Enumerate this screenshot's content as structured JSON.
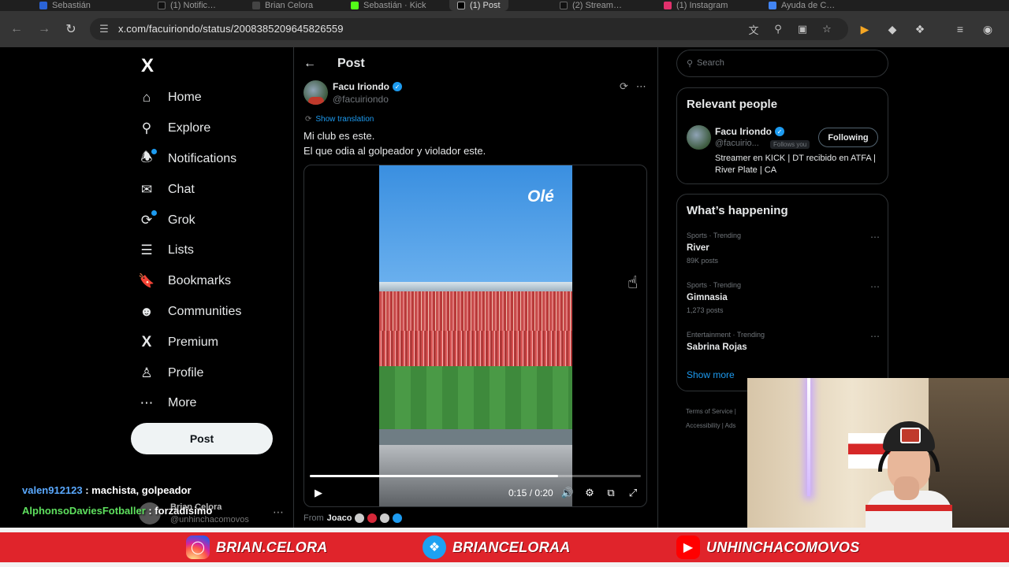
{
  "browser": {
    "tabs": [
      "Sebastián",
      "(1) Notific…",
      "Brian Celora",
      "Sebastián · Kick",
      "(1) Post",
      "(2) Stream…",
      "(1) Instagram",
      "Ayuda de C…"
    ],
    "url": "x.com/facuiriondo/status/2008385209645826559"
  },
  "sidebar": {
    "logo": "X",
    "items": [
      {
        "label": "Home",
        "icon": "home-icon"
      },
      {
        "label": "Explore",
        "icon": "search-icon"
      },
      {
        "label": "Notifications",
        "icon": "bell-icon",
        "badge": true
      },
      {
        "label": "Chat",
        "icon": "mail-icon"
      },
      {
        "label": "Grok",
        "icon": "grok-icon",
        "badge": true
      },
      {
        "label": "Lists",
        "icon": "list-icon"
      },
      {
        "label": "Bookmarks",
        "icon": "bookmark-icon"
      },
      {
        "label": "Communities",
        "icon": "communities-icon"
      },
      {
        "label": "Premium",
        "icon": "x-icon"
      },
      {
        "label": "Profile",
        "icon": "person-icon"
      },
      {
        "label": "More",
        "icon": "more-circle-icon"
      }
    ],
    "post_button": "Post",
    "account": {
      "name": "Brian Celora",
      "handle": "@unhinchacomovos"
    }
  },
  "chat_overlay": [
    {
      "user": "valen912123",
      "message": " : machista, golpeador"
    },
    {
      "user": "AlphonsoDaviesFotballer",
      "message": " : forzadisimo"
    }
  ],
  "post": {
    "header_title": "Post",
    "author_name": "Facu Iriondo",
    "author_handle": "@facuiriondo",
    "show_translation": "Show translation",
    "text_line1": "Mi club es este.",
    "text_line2": "El que odia al golpeador y violador este.",
    "video": {
      "watermark": "Olé",
      "time": "0:15 / 0:20",
      "progress": 0.75
    },
    "from_label": "From",
    "from_name": "Joaco"
  },
  "right": {
    "search_placeholder": "Search",
    "relevant_people_title": "Relevant people",
    "person": {
      "name": "Facu Iriondo",
      "handle": "@facuirio...",
      "follows_you": "Follows you",
      "button": "Following",
      "bio": "Streamer en KICK | DT recibido en ATFA | River Plate | CA"
    },
    "happening_title": "What’s happening",
    "trends": [
      {
        "category": "Sports · Trending",
        "name": "River",
        "count": "89K posts"
      },
      {
        "category": "Sports · Trending",
        "name": "Gimnasia",
        "count": "1,273 posts"
      },
      {
        "category": "Entertainment · Trending",
        "name": "Sabrina Rojas",
        "count": ""
      }
    ],
    "show_more": "Show more",
    "footer_line1": "Terms of Service  |",
    "footer_line2": "Accessibility  |  Ads"
  },
  "banner": {
    "instagram": "BRIAN.CELORA",
    "twitter": "BRIANCELORAA",
    "youtube": "UNHINCHACOMOVOS"
  },
  "colors": {
    "accent": "#1d9bf0",
    "banner_red": "#e0242b"
  }
}
